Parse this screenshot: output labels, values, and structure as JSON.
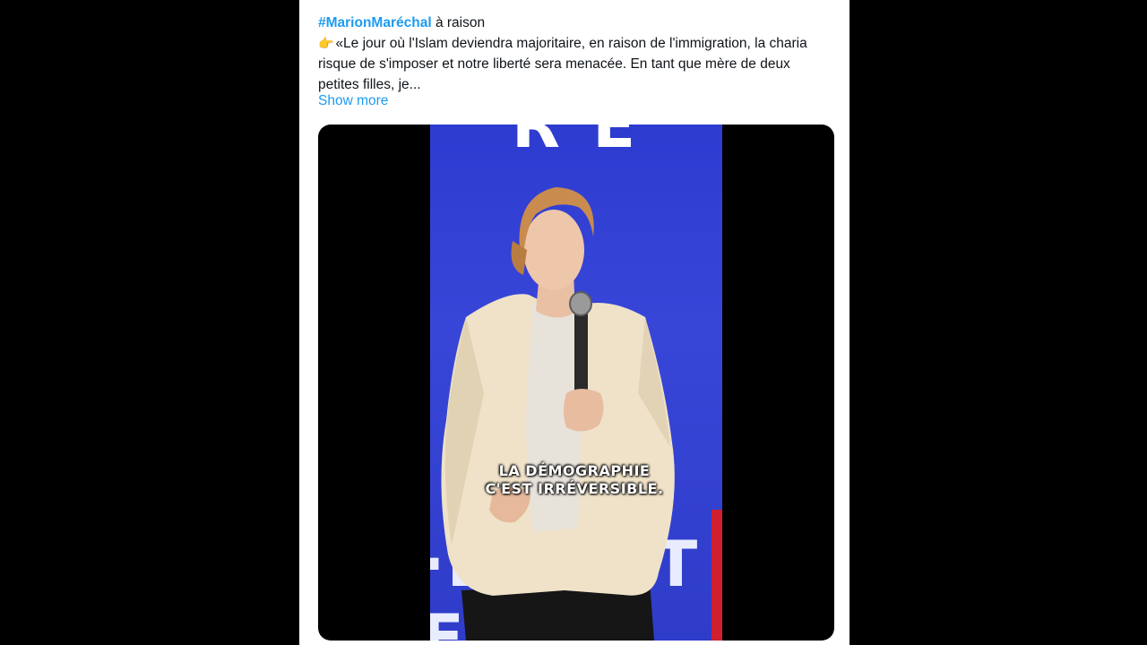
{
  "tweet": {
    "hashtag": "#MarionMaréchal",
    "hashtag_suffix": " à raison",
    "emoji_icon": "pointing-hand-icon",
    "body": "«Le jour où l'Islam deviendra majoritaire, en raison de l'immigration, la charia risque de s'imposer et notre liberté sera menacée. En tant que mère de deux petites filles, je...",
    "show_more": "Show more"
  },
  "video": {
    "caption_line1": "LA DÉMOGRAPHIE",
    "caption_line2": "C'EST IRRÉVERSIBLE."
  },
  "colors": {
    "link": "#1d9bf0",
    "stage_blue": "#3441d4",
    "accent_red": "#d01f2e"
  }
}
